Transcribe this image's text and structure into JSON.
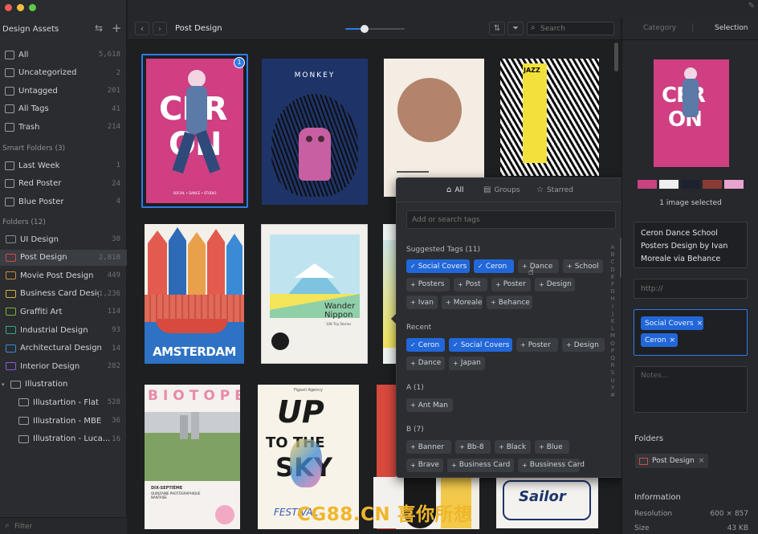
{
  "sidebar": {
    "title": "Design Assets",
    "library": [
      {
        "label": "All",
        "count": "5,618"
      },
      {
        "label": "Uncategorized",
        "count": "2"
      },
      {
        "label": "Untagged",
        "count": "201"
      },
      {
        "label": "All Tags",
        "count": "41"
      },
      {
        "label": "Trash",
        "count": "214"
      }
    ],
    "smart_header": "Smart Folders (3)",
    "smart": [
      {
        "label": "Last Week",
        "count": "1"
      },
      {
        "label": "Red Poster",
        "count": "24"
      },
      {
        "label": "Blue Poster",
        "count": "4"
      }
    ],
    "folders_header": "Folders (12)",
    "folders": [
      {
        "label": "UI Design",
        "count": "30",
        "color": "#7f8a96"
      },
      {
        "label": "Post Design",
        "count": "2,810",
        "color": "#d44a4a"
      },
      {
        "label": "Movie Post Design",
        "count": "449",
        "color": "#c98a3a"
      },
      {
        "label": "Business Card Design",
        "count": "1,236",
        "color": "#d6b23a"
      },
      {
        "label": "Graffiti Art",
        "count": "114",
        "color": "#7fb23a"
      },
      {
        "label": "Industrial Design",
        "count": "93",
        "color": "#3aa58a"
      },
      {
        "label": "Architectural Design",
        "count": "14",
        "color": "#3a8ad6"
      },
      {
        "label": "Interior Design",
        "count": "282",
        "color": "#8a5ad6"
      },
      {
        "label": "Illustration",
        "count": "",
        "color": "#9a9da3"
      },
      {
        "label": "Illustartion - Flat",
        "count": "528",
        "color": "#9a9da3"
      },
      {
        "label": "Illustration - MBE",
        "count": "36",
        "color": "#9a9da3"
      },
      {
        "label": "Illustration - Luca...",
        "count": "16",
        "color": "#9a9da3"
      }
    ],
    "filter_placeholder": "Filter"
  },
  "toolbar": {
    "breadcrumb": "Post Design",
    "zoom": 0.33,
    "search_placeholder": "Search"
  },
  "thumbs": {
    "badge": "1",
    "ceron_word1": "CER",
    "ceron_word2": "ON",
    "ceron_caption": "SOCIAL • DANCE • STUDIO",
    "monkey": "MONKEY",
    "jazz": "JAZZ",
    "amsterdam": "AMSTERDAM",
    "wander1": "Wander",
    "wander2": "Nippon",
    "wander_sub": "108 Trip Stories",
    "biotope": "BIOTOPE",
    "dix": "DIX-SEPTIÈME",
    "dix_sub": "QUINZAINE PHOTOGRAPHIQUE NANTAISE",
    "sky_top": "UP",
    "sky_mid": "TO THE",
    "sky_bot": "SKY",
    "sky_foot": "FESTIVAL",
    "sky_agency": "Figaxil Agency",
    "sailor": "Sailor"
  },
  "popup": {
    "tabs": [
      "All",
      "Groups",
      "Starred"
    ],
    "search_placeholder": "Add or search tags",
    "suggested_header": "Suggested Tags (11)",
    "suggested": [
      {
        "label": "Social Covers",
        "selected": true
      },
      {
        "label": "Ceron",
        "selected": true
      },
      {
        "label": "Dance",
        "selected": false
      },
      {
        "label": "School",
        "selected": false
      },
      {
        "label": "Posters",
        "selected": false
      },
      {
        "label": "Post",
        "selected": false
      },
      {
        "label": "Poster",
        "selected": false
      },
      {
        "label": "Design",
        "selected": false
      },
      {
        "label": "Ivan",
        "selected": false
      },
      {
        "label": "Moreale",
        "selected": false
      },
      {
        "label": "Behance",
        "selected": false
      }
    ],
    "recent_header": "Recent",
    "recent": [
      {
        "label": "Ceron",
        "selected": true
      },
      {
        "label": "Social Covers",
        "selected": true
      },
      {
        "label": "Poster",
        "selected": false
      },
      {
        "label": "Design",
        "selected": false
      },
      {
        "label": "Dance",
        "selected": false
      },
      {
        "label": "Japan",
        "selected": false
      }
    ],
    "a_header": "A (1)",
    "a_tags": [
      {
        "label": "Ant Man",
        "selected": false
      }
    ],
    "b_header": "B (7)",
    "b_tags": [
      {
        "label": "Banner",
        "selected": false
      },
      {
        "label": "Bb-8",
        "selected": false
      },
      {
        "label": "Black",
        "selected": false
      },
      {
        "label": "Blue",
        "selected": false
      },
      {
        "label": "Brave",
        "selected": false
      },
      {
        "label": "Business Card",
        "selected": false
      },
      {
        "label": "Bussiness Card",
        "selected": false
      }
    ],
    "alphabet": [
      "A",
      "B",
      "C",
      "D",
      "E",
      "F",
      "G",
      "H",
      "I",
      "J",
      "K",
      "L",
      "M",
      "O",
      "P",
      "Q",
      "R",
      "S",
      "U",
      "Y",
      "#"
    ]
  },
  "inspector": {
    "tabs": [
      "Category",
      "Selection"
    ],
    "swatches": [
      "#c8437f",
      "#efeef0",
      "#1d2230",
      "#8a3b35",
      "#e9a3cf"
    ],
    "selected_count": "1 image selected",
    "title": "Ceron Dance School Posters Design by Ivan Moreale via Behance",
    "url_placeholder": "http://",
    "tags": [
      "Social Covers",
      "Ceron"
    ],
    "notes_placeholder": "Notes...",
    "folders_header": "Folders",
    "folder_chip": "Post Design",
    "info_header": "Information",
    "info": [
      {
        "key": "Resolution",
        "value": "600 × 857"
      },
      {
        "key": "Size",
        "value": "43 KB"
      }
    ]
  },
  "watermark": "CG88.CN 喜你所想"
}
